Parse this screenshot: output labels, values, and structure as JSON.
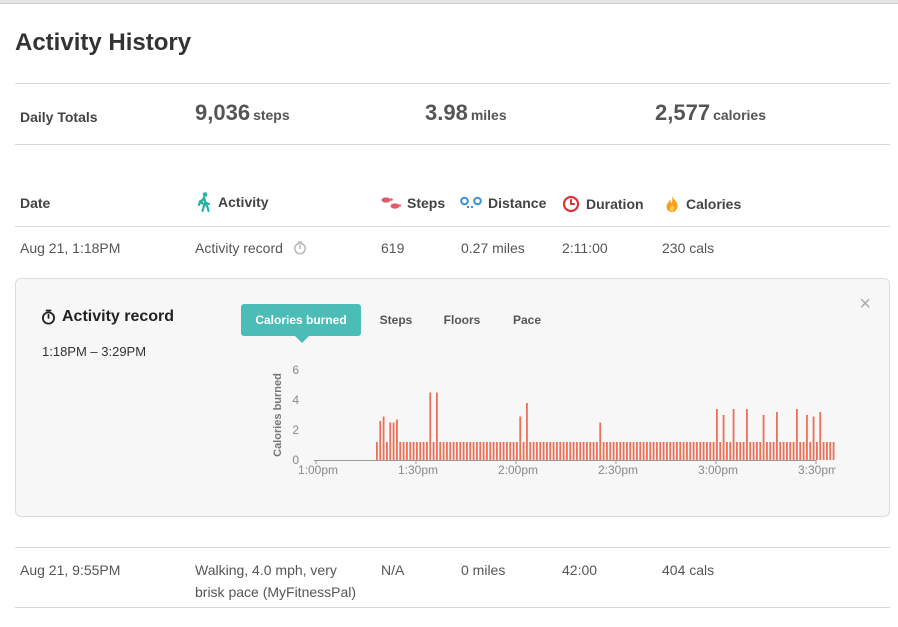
{
  "page": {
    "title": "Activity History"
  },
  "totals": {
    "label": "Daily Totals",
    "steps": {
      "value": "9,036",
      "unit": "steps"
    },
    "distance": {
      "value": "3.98",
      "unit": "miles"
    },
    "calories": {
      "value": "2,577",
      "unit": "calories"
    }
  },
  "columns": {
    "date": "Date",
    "activity": "Activity",
    "steps": "Steps",
    "distance": "Distance",
    "duration": "Duration",
    "calories": "Calories"
  },
  "colors": {
    "accent": "#4bbdb6",
    "bar": "#e8725a",
    "steps_icon": "#e05b6a",
    "distance_icon": "#3a8fd9",
    "duration_icon": "#d9343b",
    "calories_icon": "#f5a21b"
  },
  "icons": {
    "activity": "walking-person-icon",
    "steps": "footprints-icon",
    "distance": "location-pins-icon",
    "duration": "stopwatch-icon",
    "calories": "flame-icon",
    "close": "close-icon"
  },
  "rows": [
    {
      "date": "Aug 21, 1:18PM",
      "activity": "Activity record",
      "steps": "619",
      "distance": "0.27 miles",
      "duration": "2:11:00",
      "calories": "230 cals"
    },
    {
      "date": "Aug 21, 9:55PM",
      "activity_line1": "Walking, 4.0 mph, very",
      "activity_line2": "brisk pace (MyFitnessPal)",
      "steps": "N/A",
      "distance": "0 miles",
      "duration": "42:00",
      "calories": "404 cals"
    }
  ],
  "detail": {
    "title": "Activity record",
    "time_range": "1:18PM – 3:29PM",
    "close_symbol": "×",
    "tabs": [
      "Calories burned",
      "Steps",
      "Floors",
      "Pace"
    ],
    "active_tab": 0
  },
  "chart_data": {
    "type": "bar",
    "ylabel": "Calories burned",
    "ylim": [
      0,
      6
    ],
    "yticks": [
      "0",
      "2",
      "4",
      "6"
    ],
    "xticks": [
      "1:00pm",
      "1:30pm",
      "2:00pm",
      "2:30pm",
      "3:00pm",
      "3:30pm"
    ],
    "xtick_minutes": [
      0,
      30,
      60,
      90,
      120,
      150
    ],
    "x_start_minute": 18,
    "x_step_minutes": 1,
    "values": [
      1.2,
      2.6,
      2.9,
      1.2,
      2.5,
      2.5,
      2.7,
      1.2,
      1.2,
      1.2,
      1.2,
      1.2,
      1.2,
      1.2,
      1.2,
      1.2,
      4.5,
      1.2,
      4.5,
      1.2,
      1.2,
      1.2,
      1.2,
      1.2,
      1.2,
      1.2,
      1.2,
      1.2,
      1.2,
      1.2,
      1.2,
      1.2,
      1.2,
      1.2,
      1.2,
      1.2,
      1.2,
      1.2,
      1.2,
      1.2,
      1.2,
      1.2,
      1.2,
      2.9,
      1.2,
      3.8,
      1.2,
      1.2,
      1.2,
      1.2,
      1.2,
      1.2,
      1.2,
      1.2,
      1.2,
      1.2,
      1.2,
      1.2,
      1.2,
      1.2,
      1.2,
      1.2,
      1.2,
      1.2,
      1.2,
      1.2,
      1.2,
      2.5,
      1.2,
      1.2,
      1.2,
      1.2,
      1.2,
      1.2,
      1.2,
      1.2,
      1.2,
      1.2,
      1.2,
      1.2,
      1.2,
      1.2,
      1.2,
      1.2,
      1.2,
      1.2,
      1.2,
      1.2,
      1.2,
      1.2,
      1.2,
      1.2,
      1.2,
      1.2,
      1.2,
      1.2,
      1.2,
      1.2,
      1.2,
      1.2,
      1.2,
      1.2,
      3.4,
      1.2,
      3.0,
      1.2,
      1.2,
      3.4,
      1.2,
      1.2,
      1.2,
      3.4,
      1.2,
      1.2,
      1.2,
      1.2,
      3.0,
      1.2,
      1.2,
      1.2,
      3.2,
      1.2,
      1.2,
      1.2,
      1.2,
      1.2,
      3.4,
      1.2,
      1.2,
      3.0,
      1.2,
      2.9,
      1.2,
      3.2,
      1.2,
      1.2,
      1.2,
      1.2,
      1.2,
      3.6,
      1.2,
      1.2,
      1.2,
      2.8,
      1.2,
      1.2,
      1.2,
      1.2,
      1.2,
      1.2,
      1.2,
      2.5,
      1.2,
      1.2,
      1.2,
      1.2,
      1.2,
      1.2,
      1.2,
      1.2,
      1.2,
      2.9,
      1.2,
      1.2,
      2.6,
      2.9
    ]
  }
}
